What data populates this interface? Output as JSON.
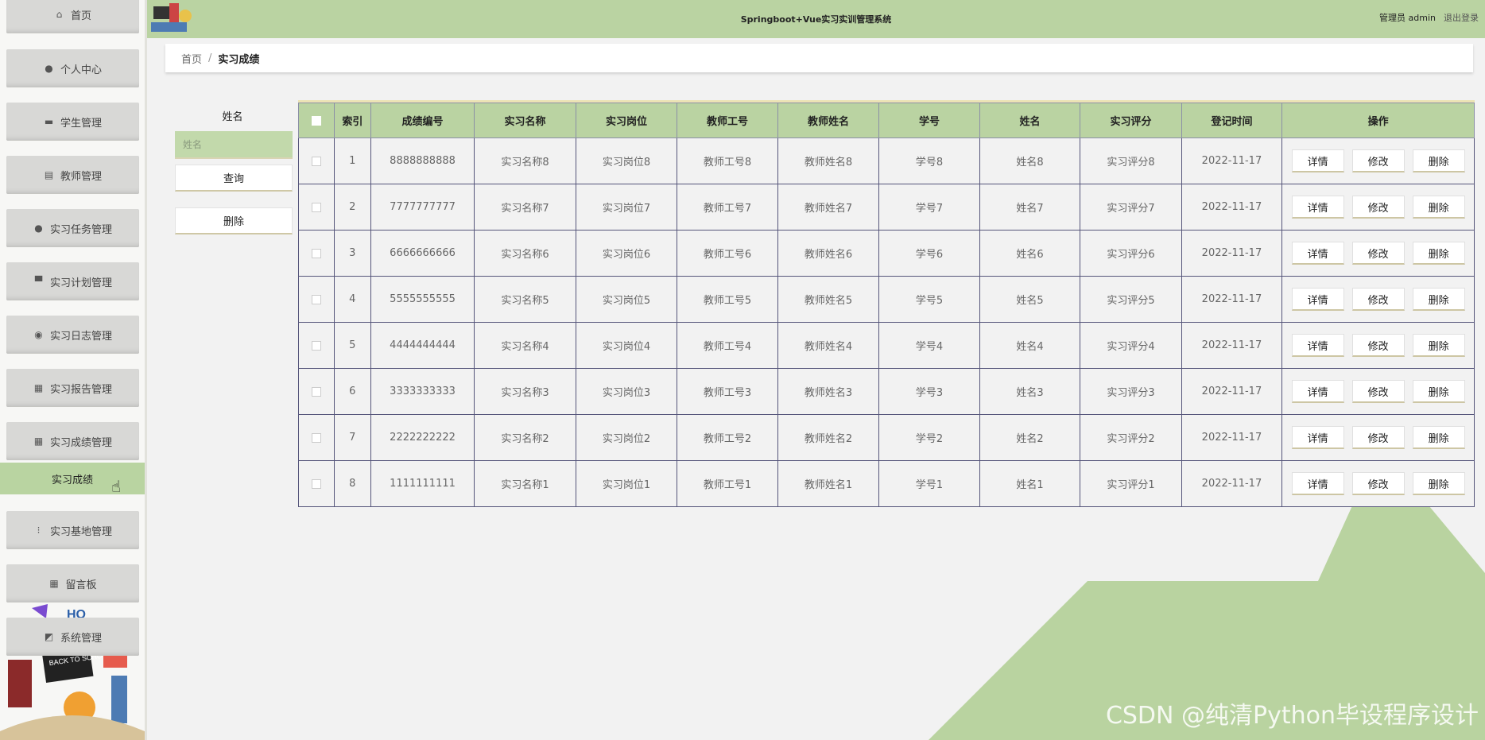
{
  "header": {
    "title": "Springboot+Vue实习实训管理系统",
    "user_label": "管理员 admin",
    "logout": "退出登录"
  },
  "sidebar": {
    "items": [
      {
        "label": "首页",
        "icon": "home-icon"
      },
      {
        "label": "个人中心",
        "icon": "user-icon"
      },
      {
        "label": "学生管理",
        "icon": "briefcase-icon"
      },
      {
        "label": "教师管理",
        "icon": "document-icon"
      },
      {
        "label": "实习任务管理",
        "icon": "user-icon"
      },
      {
        "label": "实习计划管理",
        "icon": "monitor-icon"
      },
      {
        "label": "实习日志管理",
        "icon": "location-icon"
      },
      {
        "label": "实习报告管理",
        "icon": "grid-icon"
      },
      {
        "label": "实习成绩管理",
        "icon": "grid-icon"
      },
      {
        "label": "实习基地管理",
        "icon": "apps-icon"
      },
      {
        "label": "留言板",
        "icon": "grid-icon"
      },
      {
        "label": "系统管理",
        "icon": "chart-icon"
      }
    ],
    "active_sub": "实习成绩",
    "art_text": "BACK TO SCHOOL"
  },
  "breadcrumb": {
    "home": "首页",
    "current": "实习成绩"
  },
  "search": {
    "label": "姓名",
    "placeholder": "姓名",
    "query_button": "查询",
    "delete_button": "删除"
  },
  "table": {
    "headers": [
      "索引",
      "成绩编号",
      "实习名称",
      "实习岗位",
      "教师工号",
      "教师姓名",
      "学号",
      "姓名",
      "实习评分",
      "登记时间",
      "操作"
    ],
    "rows": [
      [
        "1",
        "8888888888",
        "实习名称8",
        "实习岗位8",
        "教师工号8",
        "教师姓名8",
        "学号8",
        "姓名8",
        "实习评分8",
        "2022-11-17"
      ],
      [
        "2",
        "7777777777",
        "实习名称7",
        "实习岗位7",
        "教师工号7",
        "教师姓名7",
        "学号7",
        "姓名7",
        "实习评分7",
        "2022-11-17"
      ],
      [
        "3",
        "6666666666",
        "实习名称6",
        "实习岗位6",
        "教师工号6",
        "教师姓名6",
        "学号6",
        "姓名6",
        "实习评分6",
        "2022-11-17"
      ],
      [
        "4",
        "5555555555",
        "实习名称5",
        "实习岗位5",
        "教师工号5",
        "教师姓名5",
        "学号5",
        "姓名5",
        "实习评分5",
        "2022-11-17"
      ],
      [
        "5",
        "4444444444",
        "实习名称4",
        "实习岗位4",
        "教师工号4",
        "教师姓名4",
        "学号4",
        "姓名4",
        "实习评分4",
        "2022-11-17"
      ],
      [
        "6",
        "3333333333",
        "实习名称3",
        "实习岗位3",
        "教师工号3",
        "教师姓名3",
        "学号3",
        "姓名3",
        "实习评分3",
        "2022-11-17"
      ],
      [
        "7",
        "2222222222",
        "实习名称2",
        "实习岗位2",
        "教师工号2",
        "教师姓名2",
        "学号2",
        "姓名2",
        "实习评分2",
        "2022-11-17"
      ],
      [
        "8",
        "1111111111",
        "实习名称1",
        "实习岗位1",
        "教师工号1",
        "教师姓名1",
        "学号1",
        "姓名1",
        "实习评分1",
        "2022-11-17"
      ]
    ],
    "actions": [
      "详情",
      "修改",
      "删除"
    ]
  },
  "watermark": "CSDN @纯清Python毕设程序设计",
  "colors": {
    "accent": "#bad3a2",
    "background": "#f2f2f2"
  }
}
